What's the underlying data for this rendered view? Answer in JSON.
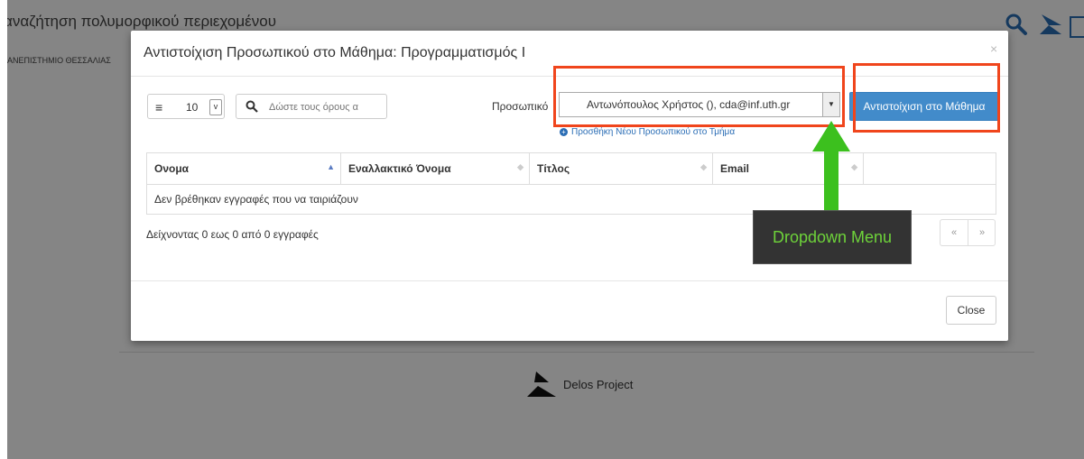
{
  "background": {
    "header_title": "αναζήτηση πολυμορφικού περιεχομένου",
    "subtitle": "ΑΝΕΠΙΣΤΗΜΙΟ ΘΕΣΣΑΛΙΑΣ",
    "footer_text": "Delos Project"
  },
  "modal": {
    "title": "Αντιστοίχιση Προσωπικού στο Μάθημα: Προγραμματισμός Ι",
    "close_x": "×",
    "page_length": "10",
    "search_placeholder": "Δώστε τους όρους α",
    "staff_label": "Προσωπικό",
    "staff_selected": "Αντωνόπουλος Χρήστος (), cda@inf.uth.gr",
    "assign_button": "Αντιστοίχιση στο Μάθημα",
    "add_staff_link": "Προσθήκη Νέου Προσωπικού στο Τμήμα",
    "table": {
      "headers": [
        "Ονομα",
        "Εναλλακτικό Όνομα",
        "Τίτλος",
        "Email",
        ""
      ],
      "empty_message": "Δεν βρέθηκαν εγγραφές που να ταιριάζουν"
    },
    "info_text": "Δείχνοντας 0 εως 0 από 0 εγγραφές",
    "pager_prev": "«",
    "pager_next": "»",
    "close_button": "Close"
  },
  "annotation": {
    "tooltip_text": "Dropdown Menu",
    "highlight_color": "#f0451c",
    "arrow_color": "#3cc01e"
  }
}
